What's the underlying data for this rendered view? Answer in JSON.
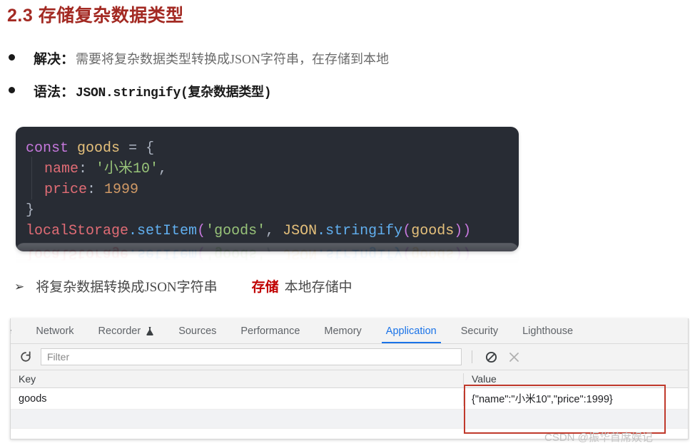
{
  "title": "2.3 存储复杂数据类型",
  "bullets": [
    {
      "marker": "●",
      "label": "解决：",
      "text": "需要将复杂数据类型转换成JSON字符串，在存储到本地",
      "mono": false
    },
    {
      "marker": "●",
      "label": "语法：",
      "text": "JSON.stringify(复杂数据类型)",
      "mono": true
    }
  ],
  "code": {
    "line1": {
      "kw": "const",
      "var": "goods",
      "op": "=",
      "brace": "{"
    },
    "line2": {
      "prop": "name",
      "colon": ":",
      "str": "'小米10'",
      "comma": ","
    },
    "line3": {
      "prop": "price",
      "colon": ":",
      "num": "1999"
    },
    "line4": {
      "brace": "}"
    },
    "line5": {
      "obj": "localStorage",
      "dot": ".",
      "fn": "setItem",
      "open": "(",
      "str": "'goods'",
      "comma": ",",
      "json": "JSON",
      "dot2": ".",
      "fn2": "stringify",
      "open2": "(",
      "arg": "goods",
      "close": "))"
    },
    "reflection_text": "localStorage.setItem('goods', JSON.stringify(goods))"
  },
  "arrow_line": {
    "marker": "➢",
    "text": "将复杂数据转换成JSON字符串",
    "emphasis": "存储",
    "tail": "本地存储中"
  },
  "devtools": {
    "tabs": [
      {
        "label": "ole",
        "icon": "",
        "active": false,
        "clipped": true
      },
      {
        "label": "Network",
        "icon": "",
        "active": false,
        "clipped": false
      },
      {
        "label": "Recorder",
        "icon": "flask-icon",
        "active": false,
        "clipped": false
      },
      {
        "label": "Sources",
        "icon": "",
        "active": false,
        "clipped": false
      },
      {
        "label": "Performance",
        "icon": "",
        "active": false,
        "clipped": false
      },
      {
        "label": "Memory",
        "icon": "",
        "active": false,
        "clipped": false
      },
      {
        "label": "Application",
        "icon": "",
        "active": true,
        "clipped": false
      },
      {
        "label": "Security",
        "icon": "",
        "active": false,
        "clipped": false
      },
      {
        "label": "Lighthouse",
        "icon": "",
        "active": false,
        "clipped": false
      }
    ],
    "toolbar": {
      "refresh_icon": "refresh-icon",
      "filter_placeholder": "Filter",
      "filter_value": "",
      "clear_icon": "block-icon",
      "close_icon": "close-icon"
    },
    "table": {
      "headers": {
        "key": "Key",
        "value": "Value"
      },
      "rows": [
        {
          "key": "goods",
          "value": "{\"name\":\"小米10\",\"price\":1999}"
        }
      ]
    }
  },
  "annotation": {
    "box_color": "#c0392b"
  },
  "watermark": "CSDN @振华首席娱记"
}
